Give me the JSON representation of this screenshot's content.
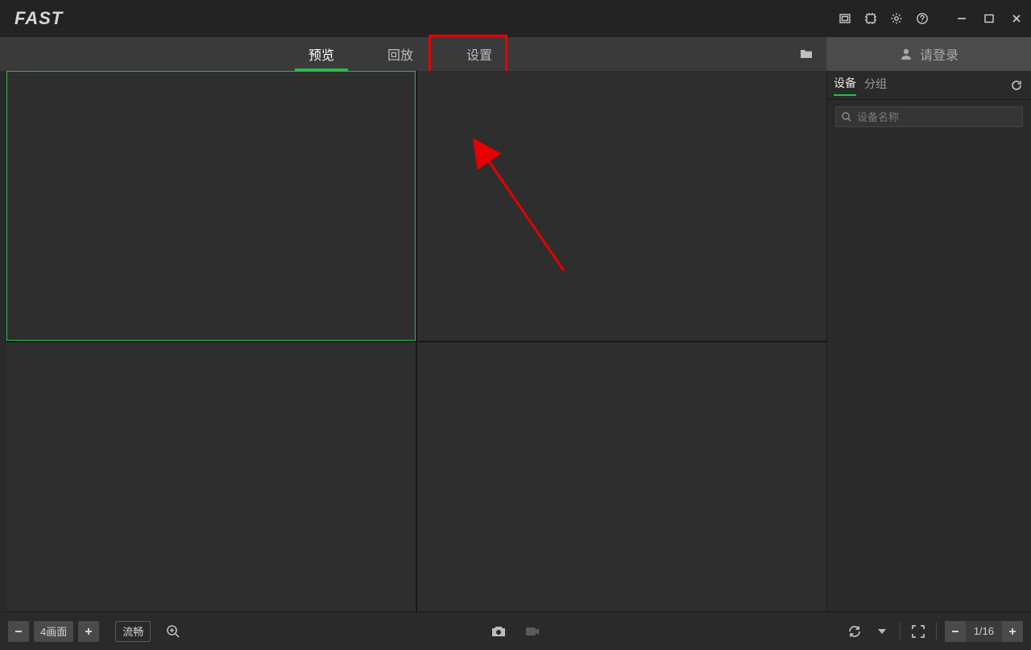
{
  "brand": "FAST",
  "tabs": {
    "preview": "预览",
    "playback": "回放",
    "settings": "设置",
    "active": "preview"
  },
  "login": {
    "label": "请登录"
  },
  "sidebar": {
    "tabs": {
      "device": "设备",
      "group": "分组",
      "active": "device"
    },
    "search_placeholder": "设备名称"
  },
  "bottombar": {
    "layout_label": "4画面",
    "stream_label": "流畅",
    "page_text": "1/16"
  },
  "titlebar_icons": [
    "screenshot-icon",
    "chip-icon",
    "gear-icon",
    "help-icon"
  ],
  "annotation": {
    "highlight_tab": "settings",
    "arrow": true
  }
}
